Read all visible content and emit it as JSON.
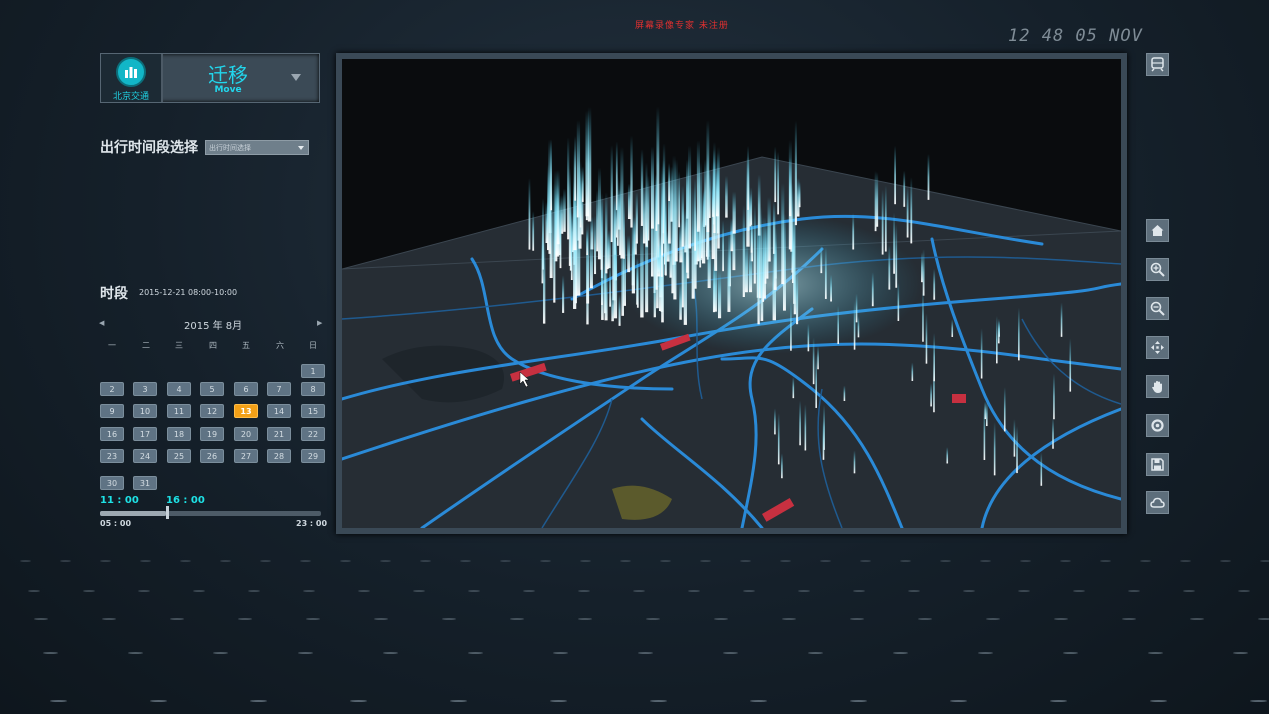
{
  "watermark": "屏幕录像专家 未注册",
  "clock": "12 48 05 NOV",
  "header": {
    "logo_text": "北京交通",
    "module_title": "迁移",
    "module_subtitle": "Move"
  },
  "period_selector": {
    "label": "出行时间段选择",
    "placeholder": "出行时间选择"
  },
  "time_section": {
    "title": "时段",
    "value": "2015-12-21 08:00-10:00"
  },
  "calendar": {
    "prev": "◀",
    "next": "▶",
    "month": "2015 年 8月",
    "weekdays": [
      "一",
      "二",
      "三",
      "四",
      "五",
      "六",
      "日"
    ],
    "days": [
      "1",
      "2",
      "3",
      "4",
      "5",
      "6",
      "7",
      "8",
      "9",
      "10",
      "11",
      "12",
      "13",
      "14",
      "15",
      "16",
      "17",
      "18",
      "19",
      "20",
      "21",
      "22",
      "23",
      "24",
      "25",
      "26",
      "27",
      "28",
      "29",
      "30",
      "31"
    ],
    "selected_day": "13"
  },
  "time_range": {
    "start": "11 : 00",
    "end": "16 : 00",
    "min": "05 : 00",
    "max": "23 : 00",
    "position_fraction": 0.3
  },
  "tools": [
    "train-icon",
    "home-icon",
    "zoom-in-icon",
    "zoom-out-icon",
    "pan-icon",
    "hand-icon",
    "settings-icon",
    "save-icon",
    "cloud-icon"
  ],
  "colors": {
    "accent": "#22d6ec",
    "selected": "#f3a017",
    "road": "#2b8fe0",
    "beam": "#bff6ff",
    "watermark": "#e03030"
  }
}
